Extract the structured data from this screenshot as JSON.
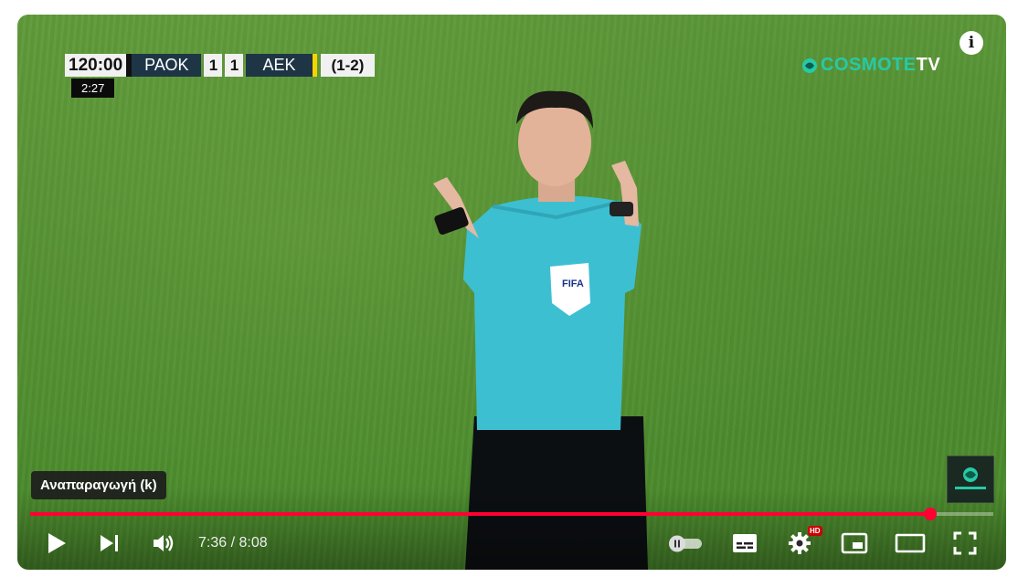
{
  "scoreboard": {
    "time": "120:00",
    "home": "ΡΑΟΚ",
    "home_score": "1",
    "away_score": "1",
    "away": "ΑΕΚ",
    "penalties": "(1-2)",
    "added_time": "2:27"
  },
  "broadcaster": {
    "name_main": "COSMOTE",
    "name_suffix": "TV"
  },
  "overlay": {
    "info_label": "i",
    "tooltip": "Αναπαραγωγή (k)"
  },
  "controls": {
    "current_time": "7:36",
    "duration": "8:08",
    "time_display": "7:36 / 8:08",
    "progress_fraction": 0.935,
    "hd_badge": "HD"
  },
  "colors": {
    "accent": "#ff0033",
    "brand": "#27c9a7",
    "scoreboard_team_bg": "#1e3546",
    "card_yellow": "#f6d400"
  },
  "icons": [
    "play-icon",
    "next-icon",
    "volume-icon",
    "autoplay-toggle-icon",
    "subtitles-icon",
    "settings-icon",
    "miniplayer-icon",
    "theater-mode-icon",
    "fullscreen-icon",
    "info-icon"
  ]
}
